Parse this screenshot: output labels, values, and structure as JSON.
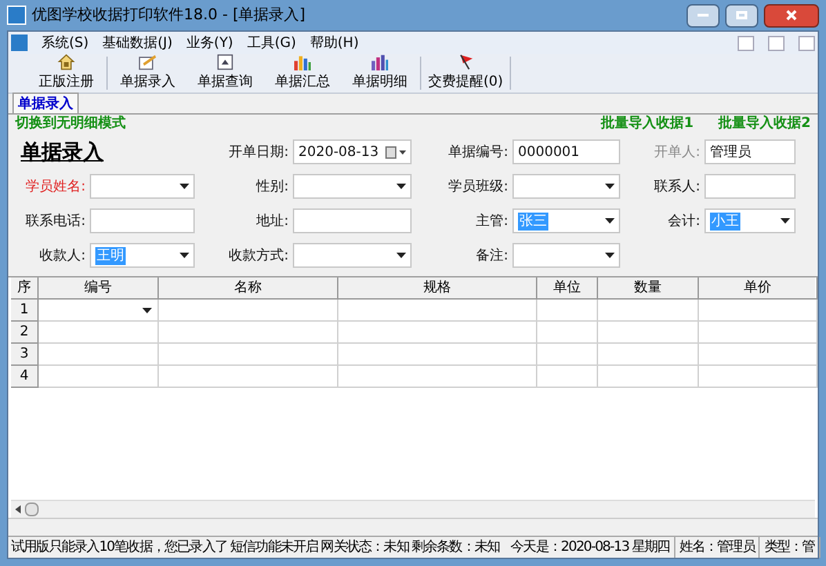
{
  "window": {
    "title": "优图学校收据打印软件18.0 - [单据录入]"
  },
  "menu": [
    {
      "label": "系统(S)"
    },
    {
      "label": "基础数据(J)"
    },
    {
      "label": "业务(Y)"
    },
    {
      "label": "工具(G)"
    },
    {
      "label": "帮助(H)"
    }
  ],
  "toolbar": [
    {
      "label": "正版注册",
      "kind": "house",
      "separator_after": true
    },
    {
      "label": "单据录入",
      "kind": "edit",
      "separator_after": false
    },
    {
      "label": "单据查询",
      "kind": "window",
      "separator_after": false
    },
    {
      "label": "单据汇总",
      "kind": "bars",
      "separator_after": false
    },
    {
      "label": "单据明细",
      "kind": "bars2",
      "separator_after": true
    },
    {
      "label": "交费提醒(0)",
      "kind": "flag",
      "separator_after": true
    }
  ],
  "tabs": [
    {
      "label": "单据录入",
      "selected": true
    }
  ],
  "links_left": [
    "切换到无明细模式"
  ],
  "links_right": [
    "批量导入收据1",
    "批量导入收据2"
  ],
  "form": {
    "rows": [
      [
        {
          "kind": "title",
          "label": "单据录入"
        },
        {
          "label": "开单日期:",
          "kind": "date",
          "value": "2020-08-13",
          "required": false,
          "disabled": false,
          "highlighted": false
        },
        {
          "label": "单据编号:",
          "kind": "text",
          "value": "0000001",
          "required": false,
          "disabled": false,
          "highlighted": false
        },
        {
          "label": "开单人:",
          "kind": "text",
          "value": "管理员",
          "required": false,
          "disabled": true,
          "highlighted": false
        }
      ],
      [
        {
          "label": "学员姓名:",
          "kind": "combo",
          "required": true,
          "disabled": false
        },
        {
          "label": "性别:",
          "kind": "combo",
          "required": false,
          "disabled": false
        },
        {
          "label": "学员班级:",
          "kind": "combo",
          "required": false,
          "disabled": false
        },
        {
          "label": "联系人:",
          "kind": "text",
          "required": false,
          "disabled": false
        }
      ],
      [
        {
          "label": "联系电话:",
          "kind": "text",
          "required": false,
          "disabled": false
        },
        {
          "label": "地址:",
          "kind": "text",
          "required": false,
          "disabled": false
        },
        {
          "label": "主管:",
          "kind": "combo",
          "value": "张三",
          "required": false,
          "disabled": false,
          "highlighted": true
        },
        {
          "label": "会计:",
          "kind": "combo",
          "value": "小王",
          "required": false,
          "disabled": false,
          "highlighted": true
        }
      ],
      [
        {
          "label": "收款人:",
          "kind": "combo",
          "value": "王明",
          "required": false,
          "disabled": false,
          "highlighted": true
        },
        {
          "label": "收款方式:",
          "kind": "combo",
          "required": false,
          "disabled": false
        },
        {
          "label": "备注:",
          "kind": "combo",
          "required": false,
          "disabled": false
        }
      ]
    ]
  },
  "table": {
    "columns": [
      "序",
      "编号",
      "名称",
      "规格",
      "单位",
      "数量",
      "单价"
    ],
    "rows": [
      {
        "index": "1",
        "dropdown": true
      },
      {
        "index": "2",
        "dropdown": false
      },
      {
        "index": "3",
        "dropdown": false
      },
      {
        "index": "4",
        "dropdown": false
      }
    ]
  },
  "status_bar": [
    "试用版只能录入10笔收据，您已录入了",
    "短信功能未开启",
    "网关状态：未知",
    "剩余条数：未知",
    "今天是：2020-08-13 星期四",
    "姓名：管理员",
    "类型：管"
  ]
}
